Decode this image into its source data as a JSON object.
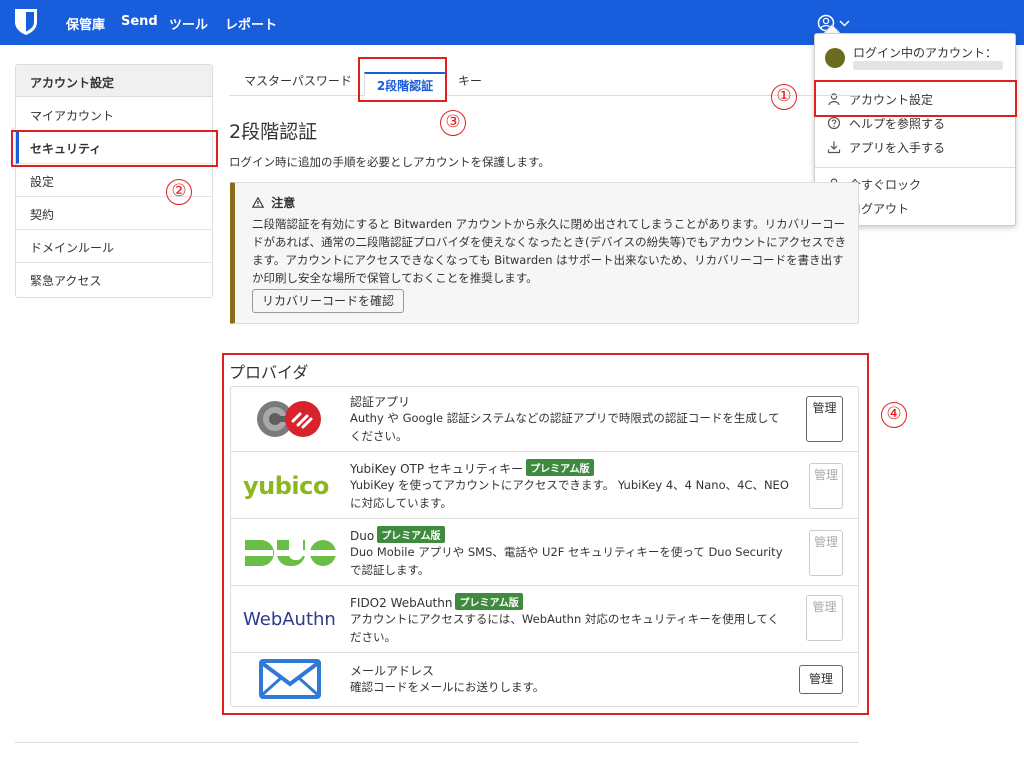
{
  "nav": {
    "vault": "保管庫",
    "send": "Send",
    "tools": "ツール",
    "reports": "レポート"
  },
  "dropdown": {
    "logged_in": "ログイン中のアカウント：",
    "items": [
      {
        "label": "アカウント設定",
        "icon": "user-icon"
      },
      {
        "label": "ヘルプを参照する",
        "icon": "question-icon"
      },
      {
        "label": "アプリを入手する",
        "icon": "download-icon"
      },
      {
        "label": "今すぐロック",
        "icon": "lock-icon"
      },
      {
        "label": "ログアウト",
        "icon": "logout-icon"
      }
    ]
  },
  "callouts": {
    "one": "①",
    "two": "②",
    "three": "③",
    "four": "④"
  },
  "sidebar": {
    "title": "アカウント設定",
    "items": [
      {
        "label": "マイアカウント"
      },
      {
        "label": "セキュリティ"
      },
      {
        "label": "設定"
      },
      {
        "label": "契約"
      },
      {
        "label": "ドメインルール"
      },
      {
        "label": "緊急アクセス"
      }
    ]
  },
  "tabs": [
    {
      "label": "マスターパスワード"
    },
    {
      "label": "2段階認証"
    },
    {
      "label": "キー"
    }
  ],
  "main": {
    "title": "2段階認証",
    "description": "ログイン時に追加の手順を必要としアカウントを保護します。",
    "warning": {
      "title": "注意",
      "body": "二段階認証を有効にすると Bitwarden アカウントから永久に閉め出されてしまうことがあります。リカバリーコードがあれば、通常の二段階認証プロバイダを使えなくなったとき(デバイスの紛失等)でもアカウントにアクセスできます。アカウントにアクセスできなくなっても Bitwarden はサポート出来ないため、リカバリーコードを書き出すか印刷し安全な場所で保管しておくことを推奨します。",
      "button": "リカバリーコードを確認"
    },
    "providers_title": "プロバイダ",
    "premium_badge": "プレミアム版",
    "providers": [
      {
        "name": "認証アプリ",
        "description": "Authy や Google 認証システムなどの認証アプリで時限式の認証コードを生成してください。",
        "button": "管理",
        "logo": "authenticator-logo"
      },
      {
        "name": "YubiKey OTP セキュリティキー",
        "description": "YubiKey を使ってアカウントにアクセスできます。 YubiKey 4、4 Nano、4C、NEOに対応しています。",
        "button": "管理",
        "logo_text": "yubico"
      },
      {
        "name": "Duo",
        "description": "Duo Mobile アプリや SMS、電話や U2F セキュリティキーを使って Duo Security で認証します。",
        "button": "管理",
        "logo": "duo-logo"
      },
      {
        "name": "FIDO2 WebAuthn",
        "description": "アカウントにアクセスするには、WebAuthn 対応のセキュリティキーを使用してください。",
        "button": "管理",
        "logo_text": "WebAuthn"
      },
      {
        "name": "メールアドレス",
        "description": "確認コードをメールにお送りします。",
        "button": "管理",
        "logo": "email-icon"
      }
    ]
  },
  "colors": {
    "brand": "#175ddc",
    "callout_red": "#e02020",
    "premium_green": "#3f8a3f"
  }
}
